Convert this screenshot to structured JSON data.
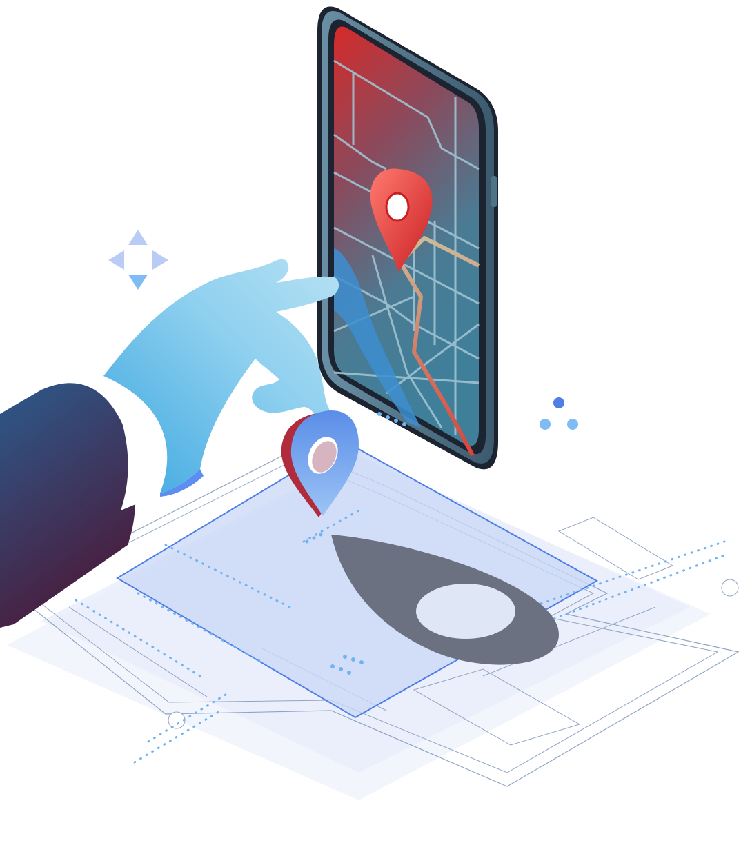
{
  "illustration": {
    "subject": "location-pin-map-illustration",
    "colors": {
      "background": "#ffffff",
      "floor_light": "#e6edfb",
      "floor_lines": "#8fa4c4",
      "selection_fill": "#c9d8f7",
      "selection_border": "#4f7fe6",
      "dots": "#6fb3f2",
      "phone_body": "#5a7d93",
      "phone_bezel": "#1b2430",
      "screen_top": "#d62a2a",
      "screen_bottom": "#3f7f9a",
      "map_roads": "#9fc3d2",
      "route": "#cdbb98",
      "pin_red": "#e83b3b",
      "pin_blue": "#6aa2f0",
      "hand": "#7cc7ee",
      "sleeve_top": "#2c5a8c",
      "sleeve_bottom": "#4a1c3c",
      "shadow": "#6b7180"
    },
    "icons": [
      "move-arrows-icon",
      "location-pin-icon",
      "dots-cluster-icon"
    ]
  }
}
